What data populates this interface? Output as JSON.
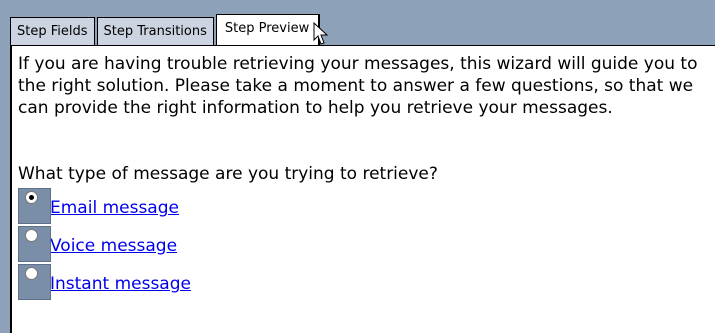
{
  "tabs": [
    {
      "label": "Step Fields",
      "active": false
    },
    {
      "label": "Step Transitions",
      "active": false
    },
    {
      "label": "Step Preview",
      "active": true
    }
  ],
  "content": {
    "intro": "If you are having trouble retrieving your messages, this wizard will guide you to the right solution. Please take a moment to answer a few questions, so that we can provide the right information to help you retrieve your messages.",
    "question": "What type of message are you trying to retrieve?",
    "options": [
      {
        "label": "Email message",
        "selected": true
      },
      {
        "label": "Voice message",
        "selected": false
      },
      {
        "label": "Instant message",
        "selected": false
      }
    ]
  },
  "colors": {
    "background": "#8da1b9",
    "tab_inactive": "#cbd4e0",
    "radio_box": "#7b8ea8",
    "link": "#0000ee"
  },
  "icons": [
    "arrow-cursor-icon"
  ]
}
